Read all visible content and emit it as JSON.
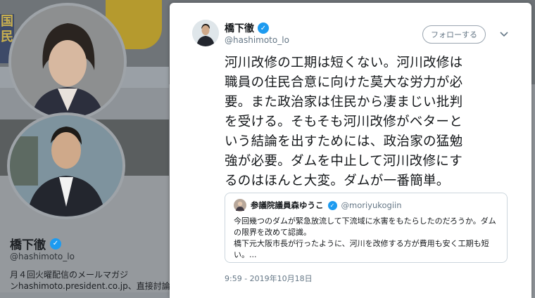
{
  "background_profile": {
    "banner_text": "国\n民",
    "name": "橋下徹",
    "handle": "@hashimoto_lo",
    "bio_line1": "月４回火曜配信のメールマガジ",
    "bio_line2": "ンhashimoto.president.co.jp、直接討論が出"
  },
  "tweet": {
    "author_name": "橋下徹",
    "author_handle": "@hashimoto_lo",
    "follow_label": "フォローする",
    "menu_icon": "chevron-down-icon",
    "text": "河川改修の工期は短くない。河川改修は\n職員の住民合意に向けた莫大な労力が必\n要。また政治家は住民から凄まじい批判\nを受ける。そもそも河川改修がベターと\nいう結論を出すためには、政治家の猛勉\n強が必要。ダムを中止して河川改修にす\nるのはほんと大変。ダムが一番簡単。",
    "quoted": {
      "name": "参議院議員森ゆうこ",
      "handle": "@moriyukogiin",
      "text": "今回幾つのダムが緊急放流して下流域に水害をもたらしたのだろうか。ダム\nの限界を改めて認識。\n橋下元大阪市長が行ったように、河川を改修する方が費用も安く工期も短\nい。..."
    },
    "timestamp": "9:59 - 2019年10月18日"
  },
  "colors": {
    "accent": "#1d9bf0",
    "overlay": "#8e9398",
    "card": "#ffffff"
  }
}
